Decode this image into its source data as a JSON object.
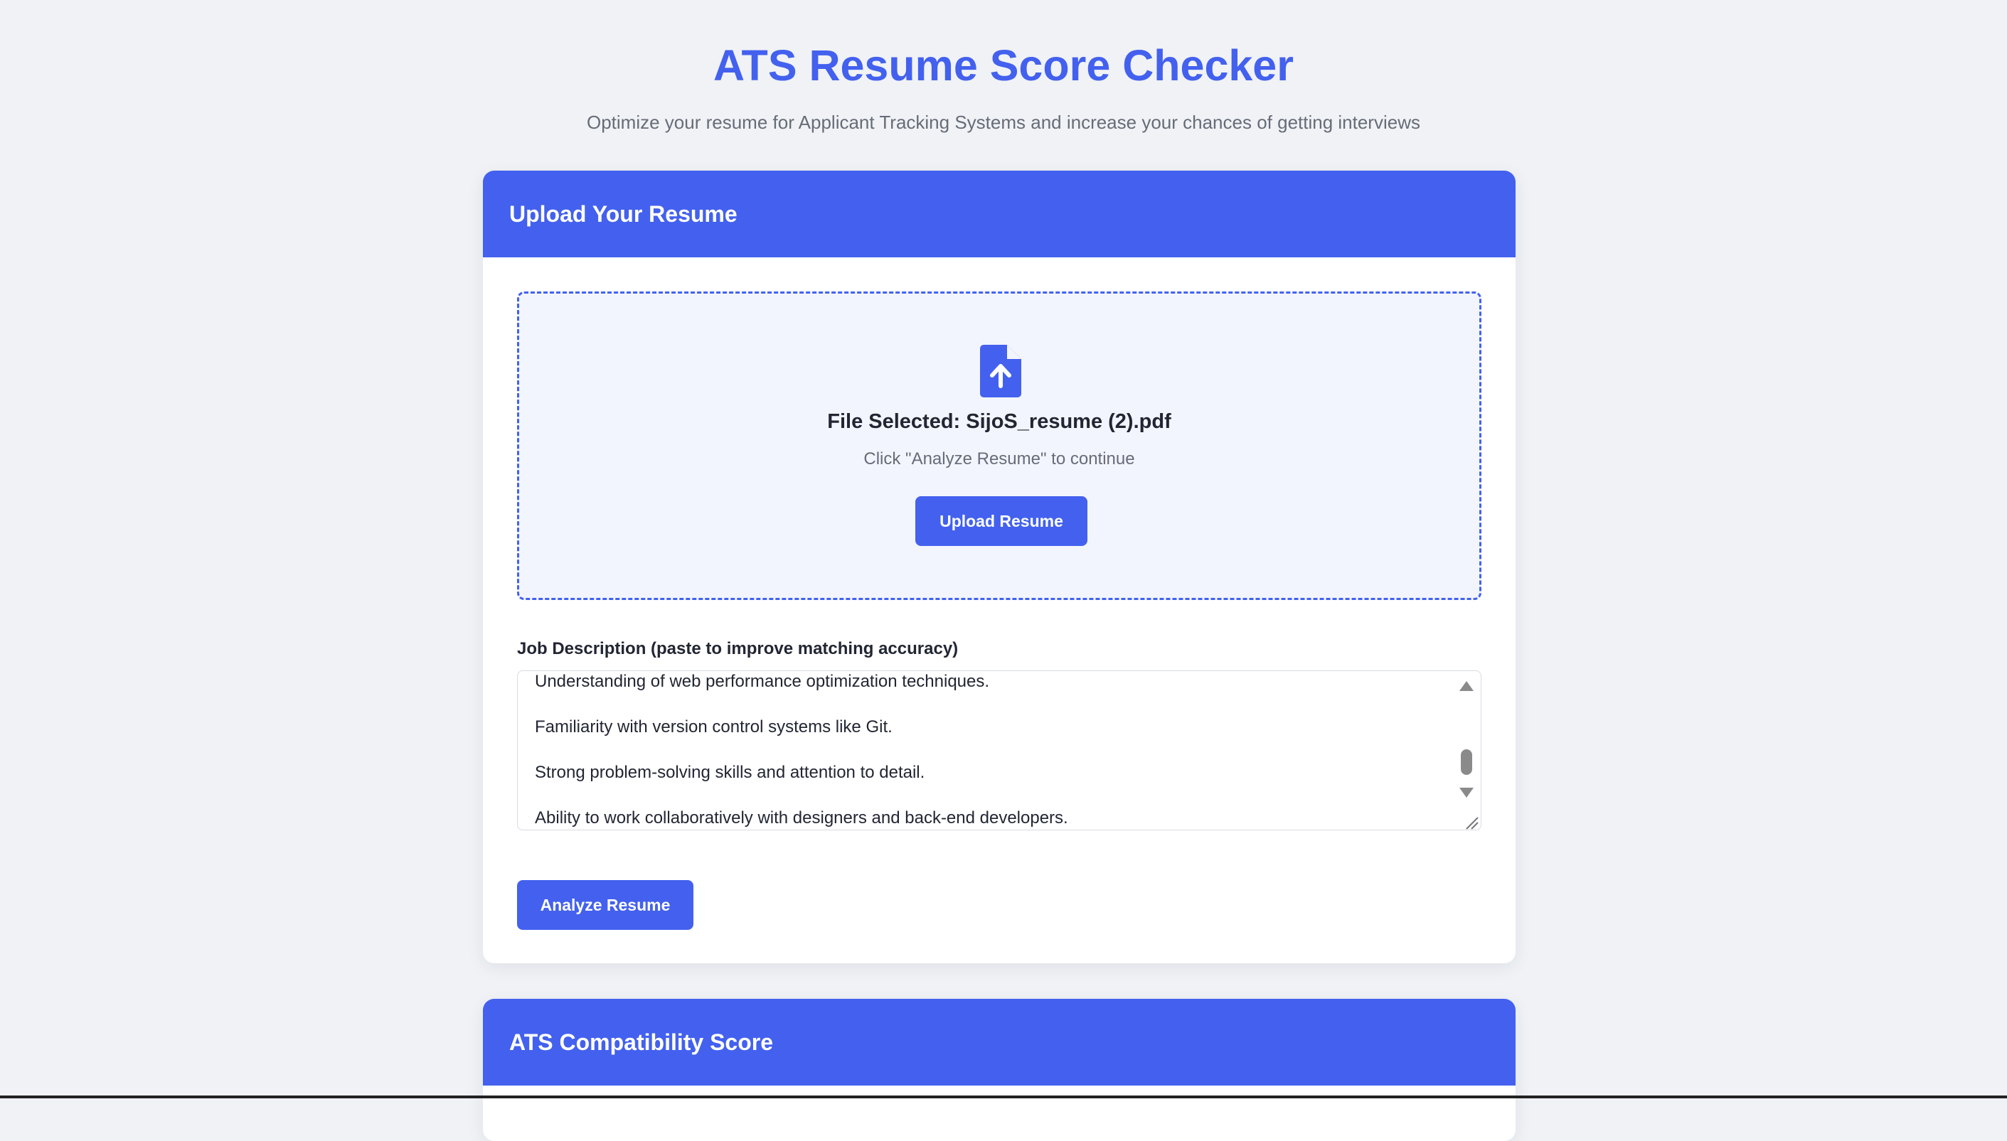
{
  "header": {
    "title": "ATS Resume Score Checker",
    "subtitle": "Optimize your resume for Applicant Tracking Systems and increase your chances of getting interviews"
  },
  "upload_card": {
    "title": "Upload Your Resume",
    "drop_zone": {
      "icon": "file-upload-icon",
      "file_selected_text": "File Selected: SijoS_resume (2).pdf",
      "hint_text": "Click \"Analyze Resume\" to continue",
      "upload_button_label": "Upload Resume"
    },
    "job_description": {
      "label": "Job Description (paste to improve matching accuracy)",
      "visible_lines": [
        "Understanding of web performance optimization techniques.",
        "Familiarity with version control systems like Git.",
        "Strong problem-solving skills and attention to detail.",
        "Ability to work collaboratively with designers and back-end developers."
      ]
    },
    "analyze_button_label": "Analyze Resume"
  },
  "score_card": {
    "title": "ATS Compatibility Score"
  },
  "colors": {
    "accent": "#4361ee",
    "background": "#f0f2f5",
    "drop_zone_bg": "#f2f5fd",
    "text": "#222633",
    "muted_text": "#666c78"
  }
}
